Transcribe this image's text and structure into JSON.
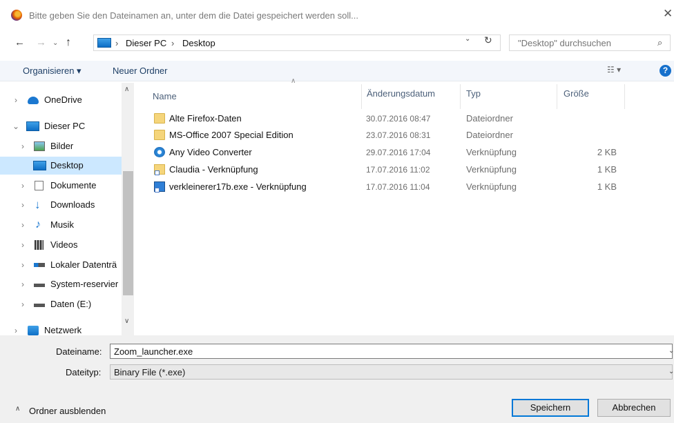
{
  "window": {
    "title": "Bitte geben Sie den Dateinamen an, unter dem die Datei gespeichert werden soll...",
    "close_icon": "close-icon"
  },
  "address": {
    "crumbs": [
      "Dieser PC",
      "Desktop"
    ],
    "separator": "›",
    "search_placeholder": "\"Desktop\" durchsuchen"
  },
  "toolbar": {
    "organize_label": "Organisieren ▾",
    "new_folder_label": "Neuer Ordner",
    "view_label": "☷ ▾",
    "help_label": "?"
  },
  "sidebar": {
    "items": [
      {
        "label": "OneDrive",
        "icon": "cloud-icon",
        "chevron": "›"
      },
      {
        "label": "Dieser PC",
        "icon": "computer-icon",
        "chevron": "⌄"
      },
      {
        "label": "Bilder",
        "icon": "pictures-icon",
        "chevron": "›"
      },
      {
        "label": "Desktop",
        "icon": "desktop-icon",
        "chevron": ""
      },
      {
        "label": "Dokumente",
        "icon": "documents-icon",
        "chevron": "›"
      },
      {
        "label": "Downloads",
        "icon": "download-icon",
        "chevron": "›"
      },
      {
        "label": "Musik",
        "icon": "music-icon",
        "chevron": "›"
      },
      {
        "label": "Videos",
        "icon": "video-icon",
        "chevron": "›"
      },
      {
        "label": "Lokaler Datenträ",
        "icon": "drive-icon",
        "chevron": "›"
      },
      {
        "label": "System-reservier",
        "icon": "drive-icon",
        "chevron": "›"
      },
      {
        "label": "Daten (E:)",
        "icon": "drive-icon",
        "chevron": "›"
      },
      {
        "label": "Netzwerk",
        "icon": "network-icon",
        "chevron": "›"
      }
    ]
  },
  "list": {
    "columns": [
      "Name",
      "Änderungsdatum",
      "Typ",
      "Größe"
    ],
    "rows": [
      {
        "name": "Alte Firefox-Daten",
        "date": "30.07.2016 08:47",
        "type": "Dateiordner",
        "size": "",
        "icon": "folder-icon"
      },
      {
        "name": "MS-Office 2007 Special Edition",
        "date": "23.07.2016 08:31",
        "type": "Dateiordner",
        "size": "",
        "icon": "folder-icon"
      },
      {
        "name": "Any Video Converter",
        "date": "29.07.2016 17:04",
        "type": "Verknüpfung",
        "size": "2 KB",
        "icon": "app-shortcut-icon"
      },
      {
        "name": "Claudia - Verknüpfung",
        "date": "17.07.2016 11:02",
        "type": "Verknüpfung",
        "size": "1 KB",
        "icon": "folder-shortcut-icon"
      },
      {
        "name": "verkleinerer17b.exe - Verknüpfung",
        "date": "17.07.2016 11:04",
        "type": "Verknüpfung",
        "size": "1 KB",
        "icon": "exe-shortcut-icon"
      }
    ]
  },
  "save": {
    "filename_label": "Dateiname:",
    "filename_value": "Zoom_launcher.exe",
    "filetype_label": "Dateityp:",
    "filetype_value": "Binary File (*.exe)",
    "hide_folders_label": "Ordner ausblenden",
    "save_button": "Speichern",
    "cancel_button": "Abbrechen"
  },
  "colors": {
    "selection": "#cce8ff",
    "accent": "#0078d7",
    "toolbar_bg": "#f3f6fb",
    "footer_bg": "#f0f0f0"
  }
}
